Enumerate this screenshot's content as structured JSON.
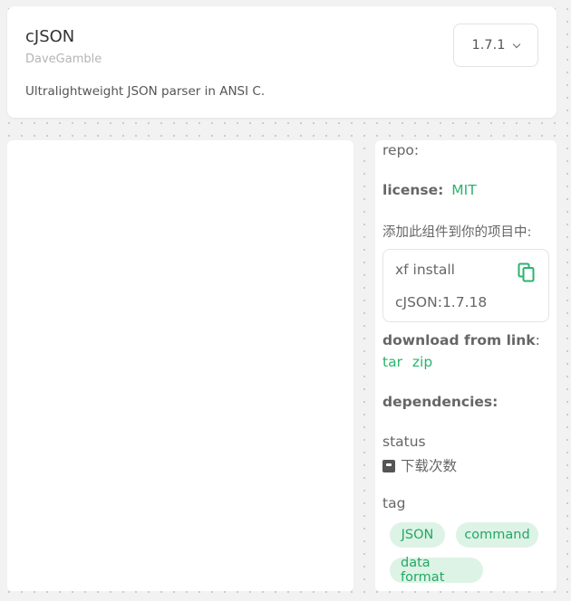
{
  "package": {
    "name": "cJSON",
    "author": "DaveGamble",
    "description": "Ultralightweight JSON parser in ANSI C.",
    "version": "1.7.1"
  },
  "sidebar": {
    "repo_label": "repo:",
    "license_label": "license:",
    "license_value": "MIT",
    "add_text": "添加此组件到你的项目中:",
    "install_line1": "xf install",
    "install_line2": "cJSON:1.7.18",
    "download_label": "download from link",
    "download_colon": ":",
    "download_tar": "tar",
    "download_zip": "zip",
    "dependencies_label": "dependencies:",
    "status_label": "status",
    "download_count_label": "下载次数",
    "tag_label": "tag",
    "tags": [
      "JSON",
      "command",
      "data format"
    ]
  },
  "colors": {
    "accent": "#2bb36e",
    "tag_bg": "#ddf3e6",
    "background": "#f2f2f2"
  }
}
